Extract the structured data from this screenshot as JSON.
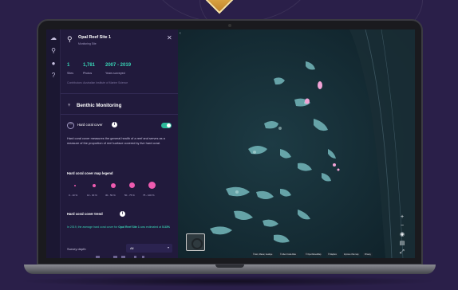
{
  "site": {
    "title": "Opal Reef Site 1",
    "subtitle": "Monitoring Site"
  },
  "stats": [
    {
      "value": "1",
      "label": "Sites"
    },
    {
      "value": "1,781",
      "label": "Photos"
    },
    {
      "value": "2007 - 2019",
      "label": "Years surveyed"
    }
  ],
  "contributors": "Contributors: Australian Institute of Marine Science",
  "section": {
    "title": "Benthic Monitoring"
  },
  "layer": {
    "name": "Hard coral cover",
    "enabled": true,
    "description": "Hard coral cover measures the general health of a reef and serves as a measure of the proportion of reef surface covered by live hard coral."
  },
  "legend": {
    "title": "Hard coral cover map legend",
    "items": [
      {
        "label": "0 - 10 %"
      },
      {
        "label": "10 - 30 %"
      },
      {
        "label": "30 - 50 %"
      },
      {
        "label": "50 - 75 %"
      },
      {
        "label": "75 - 100 %"
      }
    ]
  },
  "trend": {
    "title": "Hard coral cover trend",
    "text_prefix": "In 2019, the average hard coral cover for ",
    "site_link": "Opal Reef Site 1",
    "text_mid": " was estimated at ",
    "value": "5.33%"
  },
  "survey_depth": {
    "label": "Survey depth",
    "value": "All"
  },
  "map_attribution": [
    "© Esri, Maxar, GeoEye",
    "© Allen Coral Atlas",
    "© OpenStreetMap",
    "© Mapbox",
    "Improve this map",
    "Privacy"
  ],
  "colors": {
    "accent_teal": "#38d3b5",
    "accent_pink": "#ee5bb0",
    "panel_bg": "#211a3c"
  },
  "icons": {
    "rail": [
      "logo-icon",
      "search-icon",
      "location-icon",
      "help-icon"
    ],
    "map_controls": [
      "zoom-in-icon",
      "zoom-out-icon",
      "compass-icon",
      "layers-icon",
      "share-icon"
    ]
  }
}
